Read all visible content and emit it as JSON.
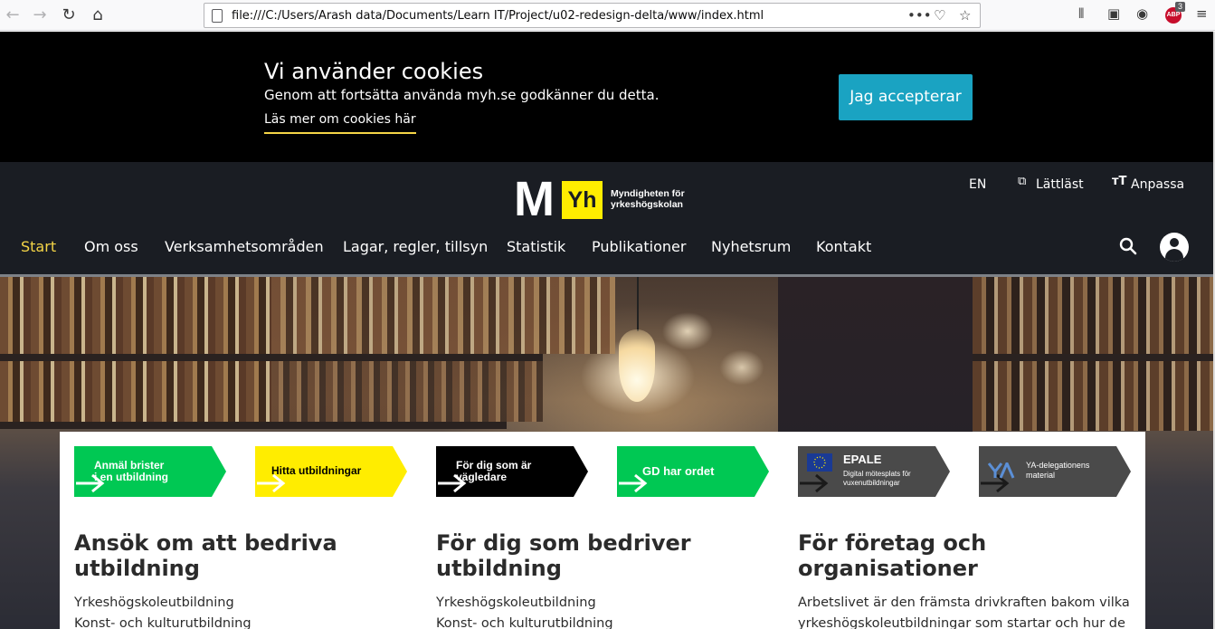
{
  "browser": {
    "url": "file:///C:/Users/Arash data/Documents/Learn IT/Project/u02-redesign-delta/www/index.html",
    "abp_label": "ABP",
    "abp_count": "3"
  },
  "cookie_banner": {
    "title": "Vi använder cookies",
    "text": "Genom att fortsätta använda myh.se godkänner du detta.",
    "link": "Läs mer om cookies här",
    "accept_button": "Jag accepterar"
  },
  "header": {
    "logo_m": "M",
    "logo_yh": "Yh",
    "logo_text_line1": "Myndigheten för",
    "logo_text_line2": "yrkeshögskolan",
    "util": {
      "lang": "EN",
      "easy_read": "Lättläst",
      "customize": "Anpassa"
    },
    "nav": [
      "Start",
      "Om oss",
      "Verksamhetsområden",
      "Lagar, regler, tillsyn",
      "Statistik",
      "Publikationer",
      "Nyhetsrum",
      "Kontakt"
    ]
  },
  "tiles": [
    {
      "line1": "Anmäl brister",
      "line2": "i en utbildning",
      "color": "#00c853"
    },
    {
      "line1": "Hitta utbildningar",
      "line2": "",
      "color": "#ffed00"
    },
    {
      "line1": "För dig som är",
      "line2": "vägledare",
      "color": "#000000"
    },
    {
      "line1": "GD har ordet",
      "line2": "",
      "color": "#00c853"
    },
    {
      "line1": "EPALE",
      "line2": "Digital mötesplats för",
      "line3": "vuxenutbildningar",
      "color": "#4a4a4a"
    },
    {
      "line1": "YA-delegationens",
      "line2": "material",
      "color": "#4a4a4a"
    }
  ],
  "sections": [
    {
      "title_line1": "Ansök om att bedriva",
      "title_line2": "utbildning",
      "line1": "Yrkeshögskoleutbildning",
      "line2": "Konst- och kulturutbildning"
    },
    {
      "title_line1": "För dig som bedriver",
      "title_line2": "utbildning",
      "line1": "Yrkeshögskoleutbildning",
      "line2": "Konst- och kulturutbildning"
    },
    {
      "title_line1": "För företag och",
      "title_line2": "organisationer",
      "line1": "Arbetslivet är den främsta drivkraften bakom vilka",
      "line2": "yrkeshögskoleutbildningar som startar och hur de"
    }
  ]
}
